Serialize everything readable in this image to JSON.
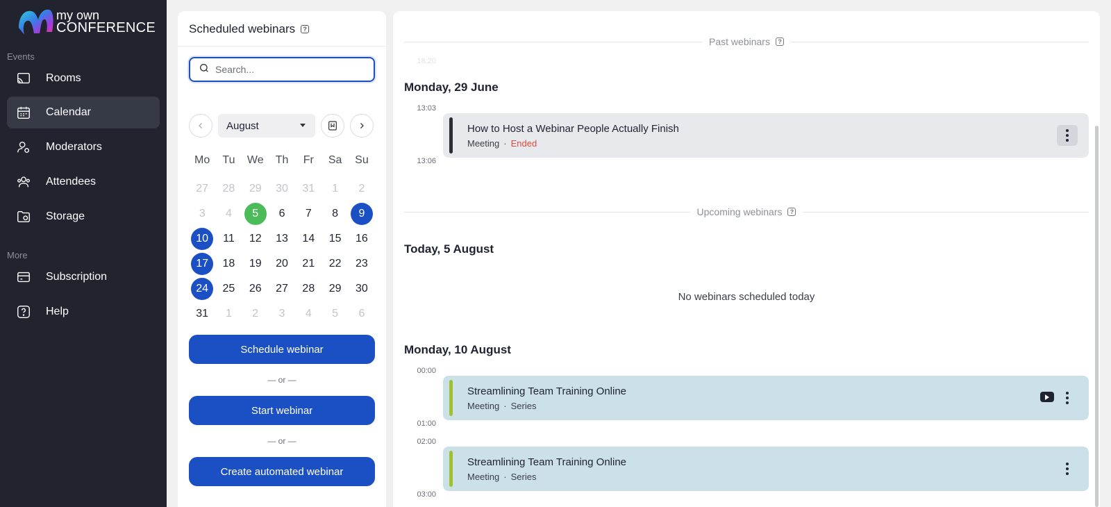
{
  "app": {
    "logo_line1": "my own",
    "logo_line2": "CONFERENCE"
  },
  "sidebar": {
    "section_events": "Events",
    "section_more": "More",
    "items": [
      {
        "label": "Rooms",
        "icon": "cast-icon"
      },
      {
        "label": "Calendar",
        "icon": "calendar-icon",
        "active": true
      },
      {
        "label": "Moderators",
        "icon": "user-cog-icon"
      },
      {
        "label": "Attendees",
        "icon": "users-icon"
      },
      {
        "label": "Storage",
        "icon": "folder-icon"
      },
      {
        "label": "Subscription",
        "icon": "card-icon"
      },
      {
        "label": "Help",
        "icon": "help-icon"
      }
    ]
  },
  "scheduled": {
    "title": "Scheduled webinars",
    "search_placeholder": "Search...",
    "month": "August",
    "weekdays": [
      "Mo",
      "Tu",
      "We",
      "Th",
      "Fr",
      "Sa",
      "Su"
    ],
    "days": [
      {
        "d": "27",
        "s": "muted"
      },
      {
        "d": "28",
        "s": "muted"
      },
      {
        "d": "29",
        "s": "muted"
      },
      {
        "d": "30",
        "s": "muted"
      },
      {
        "d": "31",
        "s": "muted"
      },
      {
        "d": "1",
        "s": "muted"
      },
      {
        "d": "2",
        "s": "muted"
      },
      {
        "d": "3",
        "s": "muted"
      },
      {
        "d": "4",
        "s": "muted"
      },
      {
        "d": "5",
        "s": "today"
      },
      {
        "d": "6",
        "s": ""
      },
      {
        "d": "7",
        "s": ""
      },
      {
        "d": "8",
        "s": ""
      },
      {
        "d": "9",
        "s": "event"
      },
      {
        "d": "10",
        "s": "event"
      },
      {
        "d": "11",
        "s": ""
      },
      {
        "d": "12",
        "s": ""
      },
      {
        "d": "13",
        "s": ""
      },
      {
        "d": "14",
        "s": ""
      },
      {
        "d": "15",
        "s": ""
      },
      {
        "d": "16",
        "s": ""
      },
      {
        "d": "17",
        "s": "event"
      },
      {
        "d": "18",
        "s": ""
      },
      {
        "d": "19",
        "s": ""
      },
      {
        "d": "20",
        "s": ""
      },
      {
        "d": "21",
        "s": ""
      },
      {
        "d": "22",
        "s": ""
      },
      {
        "d": "23",
        "s": ""
      },
      {
        "d": "24",
        "s": "event"
      },
      {
        "d": "25",
        "s": ""
      },
      {
        "d": "26",
        "s": ""
      },
      {
        "d": "27",
        "s": ""
      },
      {
        "d": "28",
        "s": ""
      },
      {
        "d": "29",
        "s": ""
      },
      {
        "d": "30",
        "s": ""
      },
      {
        "d": "31",
        "s": ""
      },
      {
        "d": "1",
        "s": "muted"
      },
      {
        "d": "2",
        "s": "muted"
      },
      {
        "d": "3",
        "s": "muted"
      },
      {
        "d": "4",
        "s": "muted"
      },
      {
        "d": "5",
        "s": "muted"
      },
      {
        "d": "6",
        "s": "muted"
      }
    ],
    "schedule_btn": "Schedule webinar",
    "or_text": "— or —",
    "start_btn": "Start webinar",
    "automated_btn": "Create automated webinar"
  },
  "timeline": {
    "past_label": "Past webinars",
    "upcoming_label": "Upcoming webinars",
    "faded_time": "18:20",
    "past_day": "Monday, 29 June",
    "past_event": {
      "start": "13:03",
      "end": "13:06",
      "title": "How to Host a Webinar People Actually Finish",
      "type": "Meeting",
      "status": "Ended"
    },
    "today_heading": "Today, 5 August",
    "today_empty": "No webinars scheduled today",
    "next_day": "Monday, 10 August",
    "events": [
      {
        "start": "00:00",
        "end": "01:00",
        "title": "Streamlining Team Training Online",
        "type": "Meeting",
        "tag": "Series"
      },
      {
        "start": "02:00",
        "end": "03:00",
        "title": "Streamlining Team Training Online",
        "type": "Meeting",
        "tag": "Series"
      }
    ],
    "colors": {
      "past_bar": "#2a2c36",
      "upcoming_bar": "#9fc22c",
      "ended": "#e0483c",
      "accent": "#1b4fc4",
      "today": "#4cbb5a"
    }
  }
}
